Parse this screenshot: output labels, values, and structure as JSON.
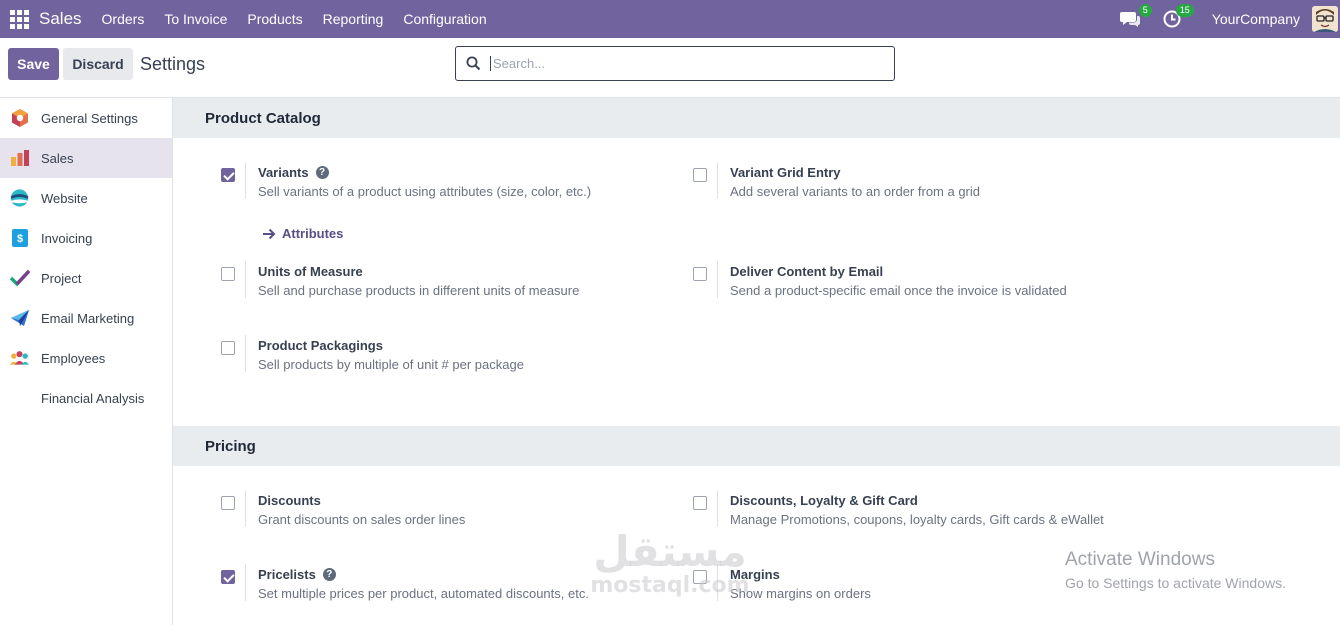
{
  "navbar": {
    "brand": "Sales",
    "menu": [
      "Orders",
      "To Invoice",
      "Products",
      "Reporting",
      "Configuration"
    ],
    "messages_count": "5",
    "activities_count": "15",
    "company": "YourCompany"
  },
  "control": {
    "save_label": "Save",
    "discard_label": "Discard",
    "title": "Settings",
    "search_placeholder": "Search..."
  },
  "sidebar": {
    "items": [
      {
        "label": "General Settings",
        "icon": "general-settings-icon"
      },
      {
        "label": "Sales",
        "icon": "sales-icon"
      },
      {
        "label": "Website",
        "icon": "website-icon"
      },
      {
        "label": "Invoicing",
        "icon": "invoicing-icon"
      },
      {
        "label": "Project",
        "icon": "project-icon"
      },
      {
        "label": "Email Marketing",
        "icon": "email-marketing-icon"
      },
      {
        "label": "Employees",
        "icon": "employees-icon"
      },
      {
        "label": "Financial Analysis",
        "icon": ""
      }
    ]
  },
  "sections": {
    "catalog": {
      "title": "Product Catalog",
      "settings": [
        {
          "label": "Variants",
          "desc": "Sell variants of a product using attributes (size, color, etc.)",
          "checked": true,
          "help": true
        },
        {
          "label": "Variant Grid Entry",
          "desc": "Add several variants to an order from a grid",
          "checked": false
        },
        {
          "label": "Units of Measure",
          "desc": "Sell and purchase products in different units of measure",
          "checked": false
        },
        {
          "label": "Deliver Content by Email",
          "desc": "Send a product-specific email once the invoice is validated",
          "checked": false
        },
        {
          "label": "Product Packagings",
          "desc": "Sell products by multiple of unit # per package",
          "checked": false
        }
      ],
      "attributes_link": "Attributes"
    },
    "pricing": {
      "title": "Pricing",
      "settings": [
        {
          "label": "Discounts",
          "desc": "Grant discounts on sales order lines",
          "checked": false
        },
        {
          "label": "Discounts, Loyalty & Gift Card",
          "desc": "Manage Promotions, coupons, loyalty cards, Gift cards & eWallet",
          "checked": false
        },
        {
          "label": "Pricelists",
          "desc": "Set multiple prices per product, automated discounts, etc.",
          "checked": true,
          "help": true
        },
        {
          "label": "Margins",
          "desc": "Show margins on orders",
          "checked": false
        }
      ]
    }
  },
  "overlays": {
    "watermark_logo": "مستقل",
    "watermark_url": "mostaql.com",
    "activate_title": "Activate Windows",
    "activate_sub": "Go to Settings to activate Windows."
  },
  "colors": {
    "primary": "#71639e",
    "badge": "#28a745",
    "section_bg": "#e9ecef",
    "active_item": "#e6e3ee"
  }
}
